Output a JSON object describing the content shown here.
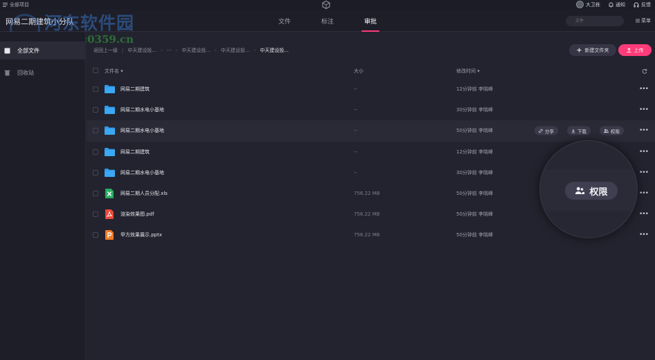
{
  "topbar": {
    "project_label": "全部项目",
    "user_name": "大卫栋",
    "notify_label": "通知",
    "feedback_label": "反馈"
  },
  "header": {
    "team_title": "网易二期建筑小分队",
    "tabs": [
      {
        "label": "文件",
        "active": false
      },
      {
        "label": "标注",
        "active": false
      },
      {
        "label": "审批",
        "active": true
      }
    ],
    "search_placeholder": "文件",
    "menu_label": "菜单"
  },
  "watermark": {
    "text": "河东软件园",
    "url": "www.pc0359.cn"
  },
  "sidebar": {
    "items": [
      {
        "label": "全部文件",
        "icon": "folder-box-icon",
        "active": true
      },
      {
        "label": "回收站",
        "icon": "trash-icon",
        "active": false
      }
    ]
  },
  "toolbar": {
    "breadcrumbs": [
      "返回上一级",
      "中天建设投...",
      "···",
      "中天建设投...",
      "中天建设投...",
      "中天建设投..."
    ],
    "new_folder_label": "新建文件夹",
    "upload_label": "上传"
  },
  "table": {
    "headers": {
      "name": "文件名",
      "size": "大小",
      "modified": "修改时间"
    },
    "rows": [
      {
        "type": "folder",
        "name": "网易二期建筑",
        "size": "--",
        "time": "12分钟前",
        "user": "李晓峰"
      },
      {
        "type": "folder",
        "name": "网易二期水电小基地",
        "size": "--",
        "time": "30分钟前",
        "user": "李晓峰"
      },
      {
        "type": "folder",
        "name": "网易二期水电小基地",
        "size": "--",
        "time": "50分钟前",
        "user": "李晓峰"
      },
      {
        "type": "folder",
        "name": "网易二期建筑",
        "size": "--",
        "time": "12分钟前",
        "user": "李晓峰"
      },
      {
        "type": "folder",
        "name": "网易二期水电小基地",
        "size": "--",
        "time": "30分钟前",
        "user": "李晓峰"
      },
      {
        "type": "xls",
        "name": "网易二期人员分配.xls",
        "size": "756.22 MB",
        "time": "50分钟前",
        "user": "李晓峰"
      },
      {
        "type": "pdf",
        "name": "渲染效果图.pdf",
        "size": "756.22 MB",
        "time": "50分钟前",
        "user": "李晓峰"
      },
      {
        "type": "pptx",
        "name": "甲方效果展示.pptx",
        "size": "756.22 MB",
        "time": "50分钟前",
        "user": "李晓峰"
      }
    ],
    "row_actions": {
      "share": "分享",
      "download": "下载",
      "permission": "权限"
    }
  },
  "magnifier": {
    "label": "权限"
  },
  "colors": {
    "accent": "#ff3b7a",
    "folder": "#2f9bea",
    "xls": "#27ae60",
    "pdf": "#e8493a",
    "pptx": "#f07d28"
  }
}
